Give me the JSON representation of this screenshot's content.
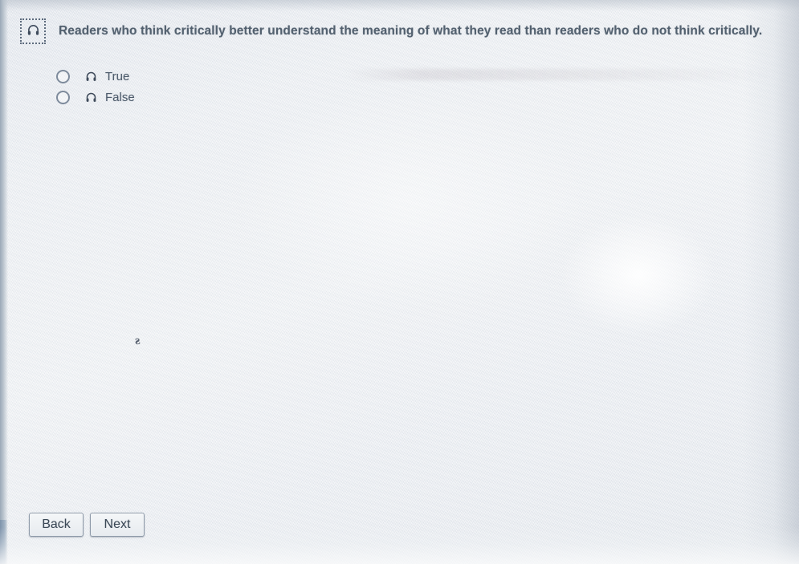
{
  "question": {
    "audio_button_icon": "headphone-icon",
    "text": "Readers who think critically better understand the meaning of what they read than readers who do not think critically."
  },
  "options": [
    {
      "label": "True",
      "icon": "headphone-icon",
      "selected": false
    },
    {
      "label": "False",
      "icon": "headphone-icon",
      "selected": false
    }
  ],
  "navigation": {
    "back_label": "Back",
    "next_label": "Next"
  },
  "artifacts": {
    "caret_glyph": "ƨ"
  },
  "colors": {
    "page_background": "#eef1f4",
    "text": "#53616f",
    "option_text": "#4e5c6c",
    "icon": "#3f4b5c",
    "radio_border": "#7e8b9c",
    "button_border": "#8d99a8",
    "button_face": "#eef1f4"
  }
}
